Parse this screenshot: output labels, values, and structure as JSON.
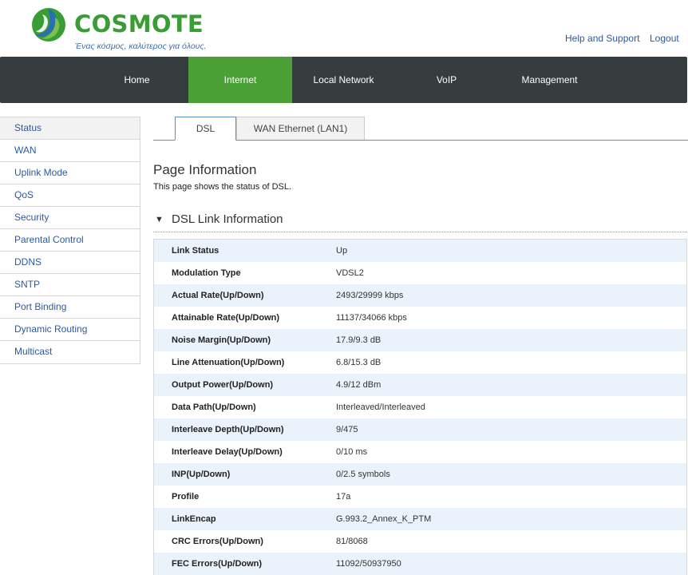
{
  "brand": {
    "name": "COSMOTE",
    "tagline": "Ένας κόσμος, καλύτερος για όλους."
  },
  "top_links": {
    "help": "Help and Support",
    "logout": "Logout"
  },
  "nav": {
    "items": [
      {
        "label": "Home"
      },
      {
        "label": "Internet",
        "active": true
      },
      {
        "label": "Local Network"
      },
      {
        "label": "VoIP"
      },
      {
        "label": "Management"
      }
    ]
  },
  "sidebar": {
    "items": [
      {
        "label": "Status",
        "active": true
      },
      {
        "label": "WAN"
      },
      {
        "label": "Uplink Mode"
      },
      {
        "label": "QoS"
      },
      {
        "label": "Security"
      },
      {
        "label": "Parental Control"
      },
      {
        "label": "DDNS"
      },
      {
        "label": "SNTP"
      },
      {
        "label": "Port Binding"
      },
      {
        "label": "Dynamic Routing"
      },
      {
        "label": "Multicast"
      }
    ]
  },
  "tabs": {
    "dsl": "DSL",
    "wan": "WAN Ethernet (LAN1)"
  },
  "page": {
    "title": "Page Information",
    "description": "This page shows the status of DSL."
  },
  "section": {
    "arrow": "▼",
    "title": "DSL Link Information"
  },
  "table": {
    "rows": [
      {
        "label": "Link Status",
        "value": "Up"
      },
      {
        "label": "Modulation Type",
        "value": "VDSL2"
      },
      {
        "label": "Actual Rate(Up/Down)",
        "value": "2493/29999 kbps"
      },
      {
        "label": "Attainable Rate(Up/Down)",
        "value": "11137/34066 kbps"
      },
      {
        "label": "Noise Margin(Up/Down)",
        "value": "17.9/9.3 dB"
      },
      {
        "label": "Line Attenuation(Up/Down)",
        "value": "6.8/15.3 dB"
      },
      {
        "label": "Output Power(Up/Down)",
        "value": "4.9/12 dBm"
      },
      {
        "label": "Data Path(Up/Down)",
        "value": "Interleaved/Interleaved"
      },
      {
        "label": "Interleave Depth(Up/Down)",
        "value": "9/475"
      },
      {
        "label": "Interleave Delay(Up/Down)",
        "value": "0/10 ms"
      },
      {
        "label": "INP(Up/Down)",
        "value": "0/2.5 symbols"
      },
      {
        "label": "Profile",
        "value": "17a"
      },
      {
        "label": "LinkEncap",
        "value": "G.993.2_Annex_K_PTM"
      },
      {
        "label": "CRC Errors(Up/Down)",
        "value": "81/8068"
      },
      {
        "label": "FEC Errors(Up/Down)",
        "value": "11092/50937950"
      }
    ]
  },
  "colors": {
    "brand_green": "#3a9c35",
    "nav_bg": "#363d3f",
    "nav_active": "#4a9f35",
    "link_blue": "#2c5aa0",
    "row_alt": "#eaf3fb"
  }
}
